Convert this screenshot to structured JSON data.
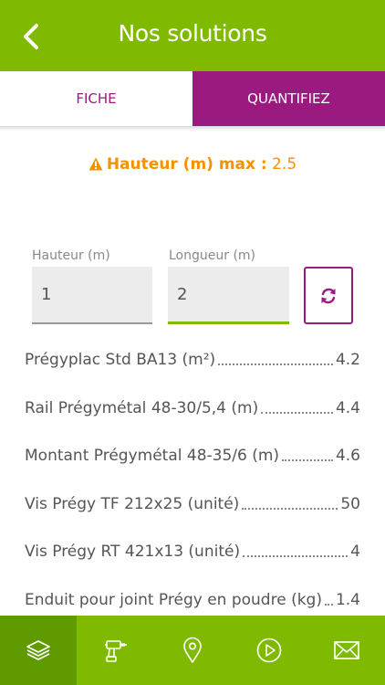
{
  "header": {
    "title": "Nos solutions"
  },
  "tabs": [
    {
      "label": "FICHE",
      "active": false
    },
    {
      "label": "QUANTIFIEZ",
      "active": true
    }
  ],
  "warning": {
    "label": "Hauteur (m) max :",
    "value": "2.5"
  },
  "inputs": {
    "hauteur": {
      "label": "Hauteur (m)",
      "value": "1"
    },
    "longueur": {
      "label": "Longueur (m)",
      "value": "2"
    }
  },
  "results": [
    {
      "name": "Prégyplac Std BA13 (m²)",
      "value": "4.2"
    },
    {
      "name": "Rail Prégymétal 48-30/5,4 (m)",
      "value": "4.4"
    },
    {
      "name": "Montant Prégymétal 48-35/6 (m)",
      "value": "4.6"
    },
    {
      "name": "Vis Prégy TF 212x25 (unité)",
      "value": "50"
    },
    {
      "name": "Vis Prégy RT 421x13 (unité)",
      "value": "4"
    },
    {
      "name": "Enduit pour joint Prégy en poudre (kg)",
      "value": "1.4"
    }
  ],
  "bottom_nav": [
    {
      "icon": "layers-icon",
      "active": true
    },
    {
      "icon": "drill-icon",
      "active": false
    },
    {
      "icon": "map-pin-icon",
      "active": false
    },
    {
      "icon": "play-icon",
      "active": false
    },
    {
      "icon": "mail-icon",
      "active": false
    }
  ],
  "colors": {
    "green": "#7fba00",
    "green_dark": "#5e9a00",
    "purple": "#9a1a7f",
    "orange": "#f39200"
  }
}
